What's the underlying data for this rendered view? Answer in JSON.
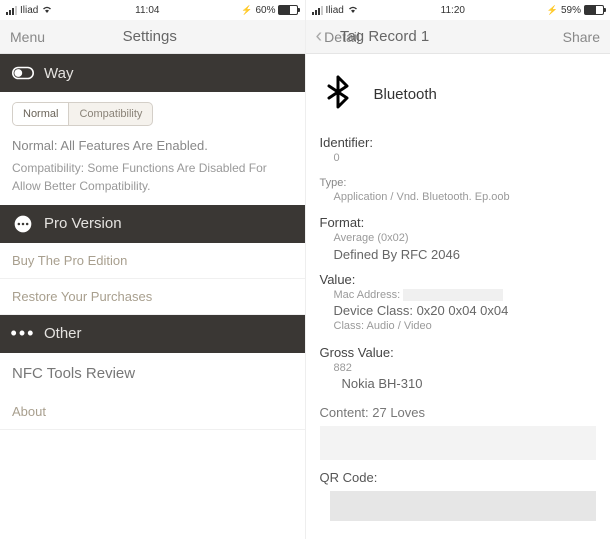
{
  "left": {
    "status": {
      "carrier": "Iliad",
      "time": "11:04",
      "battery": "60%"
    },
    "nav": {
      "left": "Menu",
      "title": "Settings"
    },
    "sections": {
      "way": {
        "title": "Way"
      },
      "segmented": {
        "opt1": "Normal",
        "opt2": "Compatibility"
      },
      "desc1": "Normal: All Features Are Enabled.",
      "desc2": "Compatibility: Some Functions Are Disabled For Allow Better Compatibility.",
      "pro": {
        "title": "Pro Version"
      },
      "buy": "Buy The Pro Edition",
      "restore": "Restore Your Purchases",
      "other": {
        "title": "Other"
      },
      "review": "NFC Tools Review",
      "about": "About"
    }
  },
  "right": {
    "status": {
      "carrier": "Iliad",
      "time": "11:20",
      "battery": "59%"
    },
    "nav": {
      "back": "Detail",
      "title": "Tag Record 1",
      "right": "Share"
    },
    "bt": "Bluetooth",
    "identifier": {
      "label": "Identifier:",
      "value": "0"
    },
    "type": {
      "label": "Type:",
      "value": "Application / Vnd. Bluetooth. Ep.oob"
    },
    "format": {
      "label": "Format:",
      "line1": "Average (0x02)",
      "line2": "Defined By RFC 2046"
    },
    "value": {
      "label": "Value:",
      "mac": "Mac Address:",
      "devclass": "Device Class: 0x20 0x04 0x04",
      "class": "Class: Audio / Video"
    },
    "gross": {
      "label": "Gross Value:",
      "line1": "882",
      "line2": "Nokia BH-310"
    },
    "content": "Content: 27 Loves",
    "qr": "QR Code:"
  }
}
